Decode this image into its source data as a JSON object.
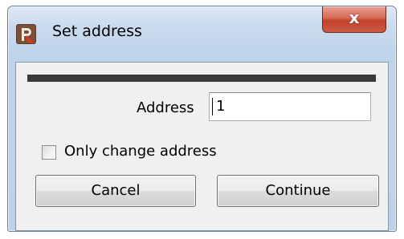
{
  "window": {
    "title": "Set address",
    "close_glyph": "x"
  },
  "form": {
    "progress": 1.0,
    "address_label": "Address",
    "address_value": "1",
    "checkbox_label": "Only change address",
    "checkbox_checked": false
  },
  "buttons": {
    "cancel_label": "Cancel",
    "continue_label": "Continue"
  },
  "colors": {
    "close_button": "#c2412b",
    "progress_fill": "#3a3a3a",
    "window_frame": "#bfd3ea"
  },
  "icons": {
    "app_icon": "app-icon",
    "close_icon": "close-icon"
  }
}
